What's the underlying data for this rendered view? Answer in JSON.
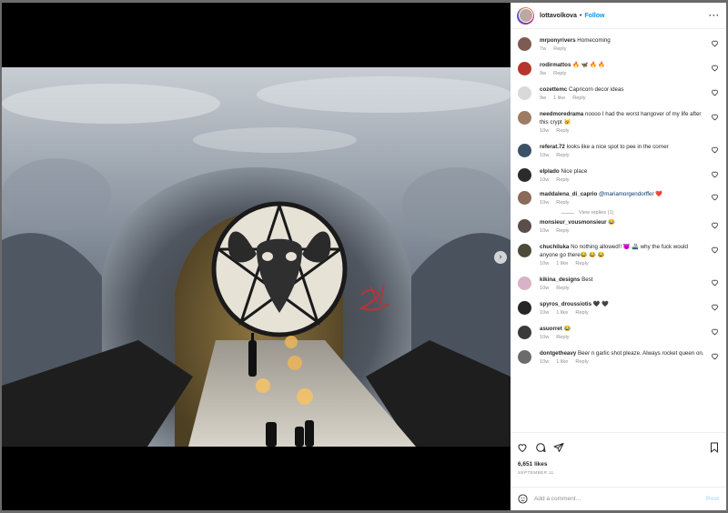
{
  "header": {
    "username": "lottavolkova",
    "separator": "•",
    "follow_label": "Follow",
    "more_label": "···"
  },
  "media": {
    "alt": "Vaulted crypt tunnel with goat skull pentagram and candles on a table",
    "next_label": "›"
  },
  "comments": [
    {
      "user": "mrponyrivers",
      "text": "Homecoming",
      "age": "7w",
      "likes": "",
      "reply": "Reply",
      "avatar_color": "#7b5b52"
    },
    {
      "user": "rodirmattos",
      "text": "🔥 🦋 🔥 🔥",
      "age": "9w",
      "likes": "",
      "reply": "Reply",
      "avatar_color": "#b5362c"
    },
    {
      "user": "cozettemc",
      "text": "Capricorn decor ideas",
      "age": "9w",
      "likes": "1 like",
      "reply": "Reply",
      "avatar_color": "#d9d9d9"
    },
    {
      "user": "needmoredrama",
      "text": "noooo I had the worst hangover of my life after this crypt 😿",
      "age": "10w",
      "likes": "",
      "reply": "Reply",
      "avatar_color": "#9c7d63"
    },
    {
      "user": "referat.72",
      "text": "looks like a nice spot to pee in the corner",
      "age": "10w",
      "likes": "",
      "reply": "Reply",
      "avatar_color": "#3b5166"
    },
    {
      "user": "elplado",
      "text": "Nice place",
      "age": "10w",
      "likes": "",
      "reply": "Reply",
      "avatar_color": "#2d2a2a"
    },
    {
      "user": "maddalena_di_caprio",
      "text": "",
      "mention": "@mariamorgendorffer",
      "emoji": "❤️",
      "age": "10w",
      "likes": "",
      "reply": "Reply",
      "avatar_color": "#8a6a5a",
      "view_replies": "View replies (1)"
    },
    {
      "user": "monsieur_vousmonsieur",
      "text": "😂",
      "age": "10w",
      "likes": "",
      "reply": "Reply",
      "avatar_color": "#5a4e4a"
    },
    {
      "user": "chuchiluka",
      "text": "No nothing allowed!! 😈 🚢 why the fuck would anyone go there😂 😂 😂",
      "age": "10w",
      "likes": "1 like",
      "reply": "Reply",
      "avatar_color": "#4d4a3a"
    },
    {
      "user": "kikina_designs",
      "text": "Best",
      "age": "10w",
      "likes": "",
      "reply": "Reply",
      "avatar_color": "#d8b3c7"
    },
    {
      "user": "spyros_droussiotis",
      "text": "🖤 🖤",
      "age": "10w",
      "likes": "1 like",
      "reply": "Reply",
      "avatar_color": "#262626"
    },
    {
      "user": "asuorret",
      "text": "😂",
      "age": "10w",
      "likes": "",
      "reply": "Reply",
      "avatar_color": "#3a3a3a"
    },
    {
      "user": "dontgetheavy",
      "text": "Beer n garlic shot pleaze. Always rocket queen on.",
      "age": "10w",
      "likes": "1 like",
      "reply": "Reply",
      "avatar_color": "#6b6b6b"
    }
  ],
  "footer": {
    "likes": "6,651 likes",
    "date": "SEPTEMBER 11",
    "add_comment_placeholder": "Add a comment…",
    "post_label": "Post"
  },
  "colors": {
    "accent": "#0095f6",
    "text": "#262626",
    "muted": "#8e8e8e",
    "post_disabled": "#b2dffc"
  }
}
